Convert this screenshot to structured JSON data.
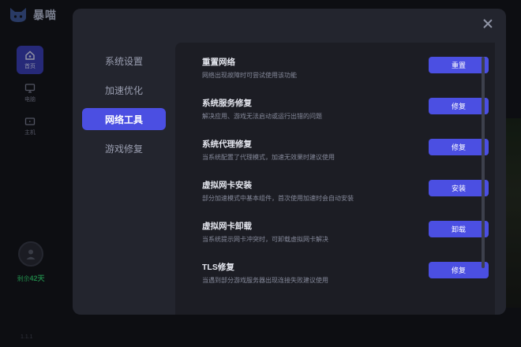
{
  "app": {
    "brand": "暴喵",
    "rail": [
      {
        "label": "首页",
        "icon": "home-icon",
        "active": true
      },
      {
        "label": "电脑",
        "icon": "monitor-icon",
        "active": false
      },
      {
        "label": "主机",
        "icon": "tv-icon",
        "active": false
      }
    ],
    "remaining": {
      "prefix": "剩余",
      "days": "42天"
    },
    "version": "1.1.1"
  },
  "modal": {
    "nav": [
      {
        "label": "系统设置",
        "active": false
      },
      {
        "label": "加速优化",
        "active": false
      },
      {
        "label": "网络工具",
        "active": true
      },
      {
        "label": "游戏修复",
        "active": false
      }
    ],
    "tools": [
      {
        "title": "重置网络",
        "desc": "网络出现故障时可尝试使用该功能",
        "button": "重置"
      },
      {
        "title": "系统服务修复",
        "desc": "解决应用、游戏无法启动或运行出错的问题",
        "button": "修复"
      },
      {
        "title": "系统代理修复",
        "desc": "当系统配置了代理模式，加速无效果时建议使用",
        "button": "修复"
      },
      {
        "title": "虚拟网卡安装",
        "desc": "部分加速模式中基本组件，首次使用加速时会自动安装",
        "button": "安装"
      },
      {
        "title": "虚拟网卡卸载",
        "desc": "当系统提示网卡冲突时，可卸载虚拟网卡解决",
        "button": "卸载"
      },
      {
        "title": "TLS修复",
        "desc": "当遇到部分游戏服务器出现连接失败建议使用",
        "button": "修复"
      }
    ]
  },
  "colors": {
    "accent": "#4b4fe2",
    "success": "#2fc46a"
  }
}
